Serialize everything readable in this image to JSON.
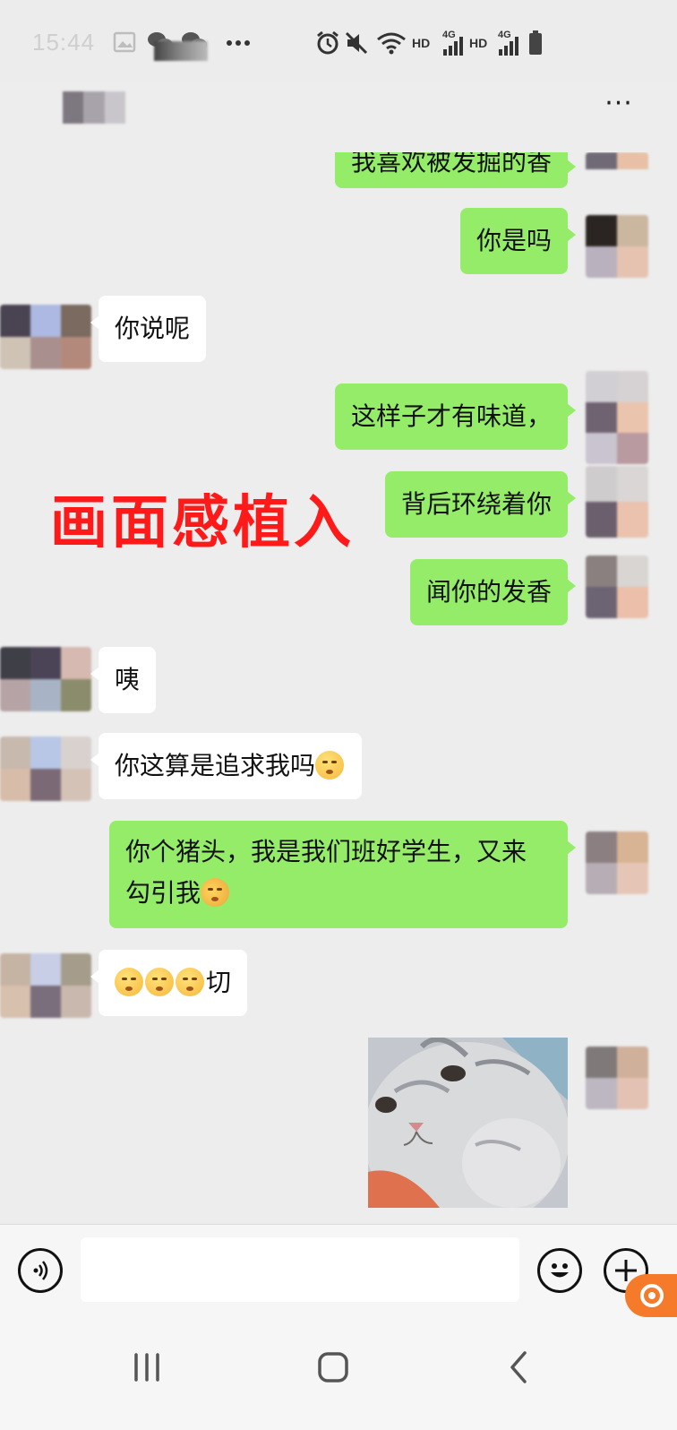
{
  "status_bar": {
    "time": "15:44",
    "network_left": {
      "label": "HD",
      "sub": "4G"
    },
    "network_right": {
      "label": "HD",
      "sub": "4G"
    }
  },
  "header": {
    "more_label": "···"
  },
  "messages": [
    {
      "id": "m1",
      "direction": "out",
      "text": "我喜欢被发掘的香"
    },
    {
      "id": "m2",
      "direction": "out",
      "text": "你是吗"
    },
    {
      "id": "m3",
      "direction": "in",
      "text": "你说呢"
    },
    {
      "id": "m4",
      "direction": "out",
      "text": "这样子才有味道，"
    },
    {
      "id": "m5",
      "direction": "out",
      "text": "背后环绕着你"
    },
    {
      "id": "m6",
      "direction": "out",
      "text": "闻你的发香"
    },
    {
      "id": "m7",
      "direction": "in",
      "text": "咦"
    },
    {
      "id": "m8",
      "direction": "in",
      "text": "你这算是追求我吗"
    },
    {
      "id": "m9",
      "direction": "out",
      "text_line1": "你个猪头，我是我们班好学生，又来",
      "text_line2": "勾引我"
    },
    {
      "id": "m10",
      "direction": "in",
      "text": "切"
    },
    {
      "id": "m11",
      "direction": "out",
      "type": "sticker"
    }
  ],
  "overlay_caption": "画面感植入",
  "input_bar": {
    "placeholder": ""
  },
  "colors": {
    "background": "#ededed",
    "outgoing_bubble": "#95ec69",
    "incoming_bubble": "#ffffff",
    "caption_red": "#ff1a1a",
    "badge_orange": "#f57a2a"
  },
  "icons": [
    "gallery-icon",
    "wechat-icon",
    "alarm-icon",
    "mute-icon",
    "wifi-icon",
    "signal-icon",
    "battery-icon",
    "voice-icon",
    "emoji-icon",
    "plus-icon",
    "nav-recents-icon",
    "nav-home-icon",
    "nav-back-icon"
  ]
}
